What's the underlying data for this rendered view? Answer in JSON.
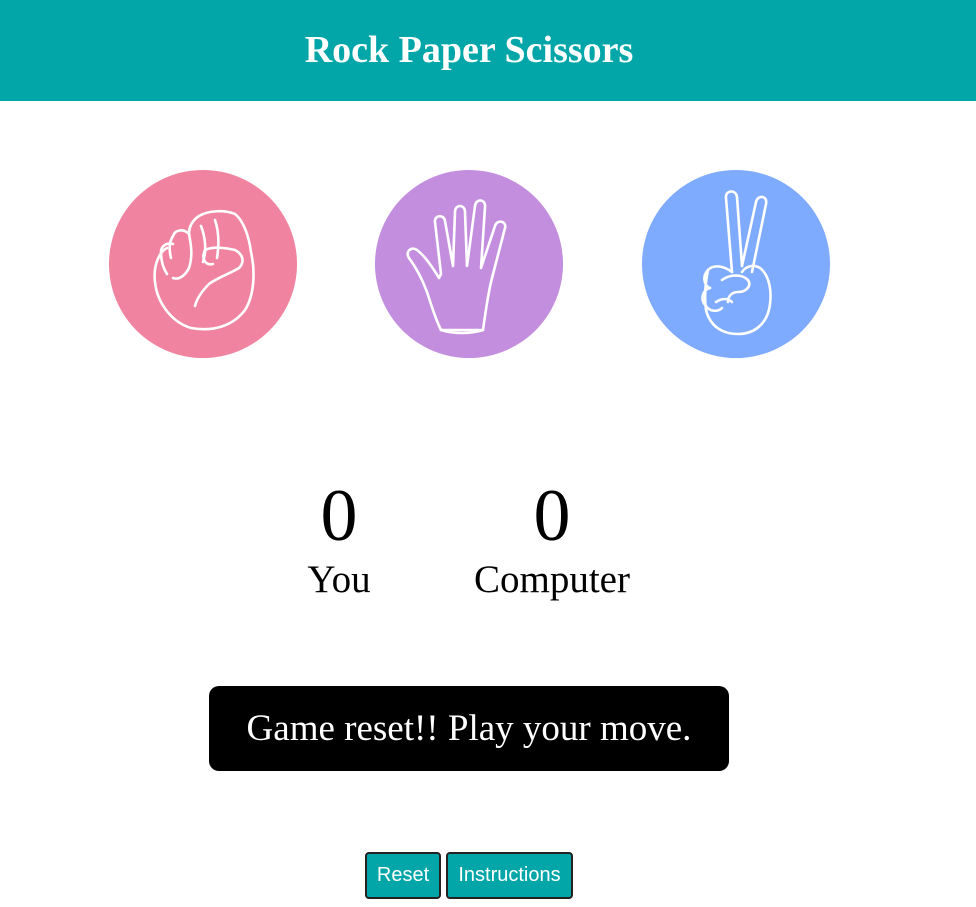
{
  "header": {
    "title": "Rock Paper Scissors",
    "background": "#03a6a8"
  },
  "choices": [
    {
      "id": "rock",
      "icon": "fist-icon",
      "color": "#f0839f"
    },
    {
      "id": "paper",
      "icon": "open-hand-icon",
      "color": "#c48ede"
    },
    {
      "id": "scissors",
      "icon": "peace-hand-icon",
      "color": "#7eabfd"
    }
  ],
  "scoreboard": {
    "user_score": "0",
    "user_label": "You",
    "computer_score": "0",
    "computer_label": "Computer"
  },
  "message": {
    "text": "Game reset!! Play your move."
  },
  "buttons": {
    "reset_label": "Reset",
    "instructions_label": "Instructions"
  }
}
